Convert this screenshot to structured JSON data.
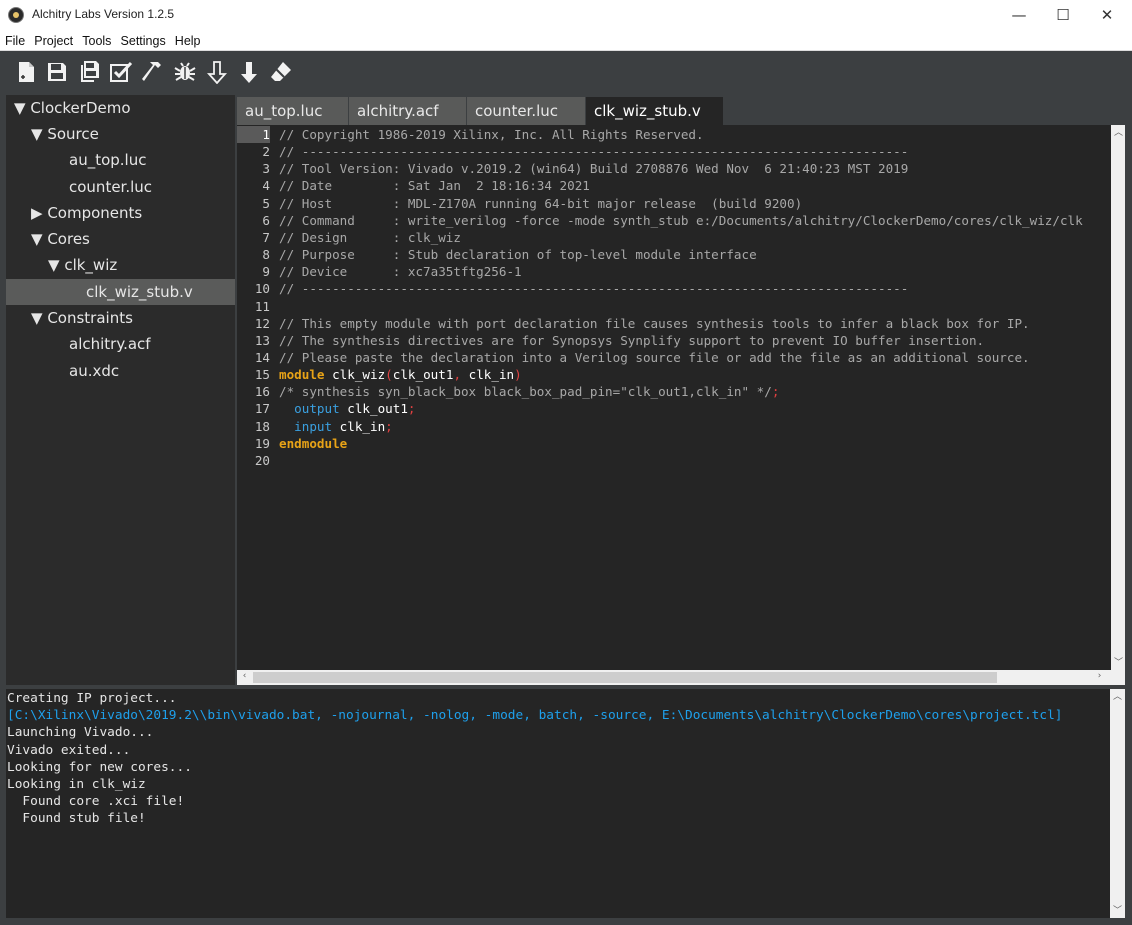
{
  "window": {
    "title": "Alchitry Labs Version 1.2.5",
    "buttons": [
      "—",
      "☐",
      "✕"
    ]
  },
  "menu": [
    "File",
    "Project",
    "Tools",
    "Settings",
    "Help"
  ],
  "toolbar": {
    "buttons": [
      "new-file",
      "save",
      "save-all",
      "check",
      "build",
      "debug",
      "load-ram",
      "load-flash",
      "erase"
    ]
  },
  "tree": {
    "items": [
      {
        "label": "ClockerDemo",
        "arrow": "▼"
      },
      {
        "label": "Source",
        "arrow": "▼"
      },
      {
        "label": "au_top.luc",
        "arrow": ""
      },
      {
        "label": "counter.luc",
        "arrow": ""
      },
      {
        "label": "Components",
        "arrow": "▶"
      },
      {
        "label": "Cores",
        "arrow": "▼"
      },
      {
        "label": "clk_wiz",
        "arrow": "▼"
      },
      {
        "label": "clk_wiz_stub.v",
        "arrow": ""
      },
      {
        "label": "Constraints",
        "arrow": "▼"
      },
      {
        "label": "alchitry.acf",
        "arrow": ""
      },
      {
        "label": "au.xdc",
        "arrow": ""
      }
    ]
  },
  "tabs": [
    {
      "label": "au_top.luc"
    },
    {
      "label": "alchitry.acf"
    },
    {
      "label": "counter.luc"
    },
    {
      "label": "clk_wiz_stub.v"
    }
  ],
  "editor": {
    "lines": [
      {
        "n": "1",
        "segs": [
          {
            "t": "// Copyright 1986-2019 Xilinx, Inc. All Rights Reserved.",
            "c": "#a8a8a8"
          }
        ]
      },
      {
        "n": "2",
        "segs": [
          {
            "t": "// --------------------------------------------------------------------------------",
            "c": "#a8a8a8"
          }
        ]
      },
      {
        "n": "3",
        "segs": [
          {
            "t": "// Tool Version: Vivado v.2019.2 (win64) Build 2708876 Wed Nov  6 21:40:23 MST 2019",
            "c": "#a8a8a8"
          }
        ]
      },
      {
        "n": "4",
        "segs": [
          {
            "t": "// Date        : Sat Jan  2 18:16:34 2021",
            "c": "#a8a8a8"
          }
        ]
      },
      {
        "n": "5",
        "segs": [
          {
            "t": "// Host        : MDL-Z170A running 64-bit major release  (build 9200)",
            "c": "#a8a8a8"
          }
        ]
      },
      {
        "n": "6",
        "segs": [
          {
            "t": "// Command     : write_verilog -force -mode synth_stub e:/Documents/alchitry/ClockerDemo/cores/clk_wiz/clk",
            "c": "#a8a8a8"
          }
        ]
      },
      {
        "n": "7",
        "segs": [
          {
            "t": "// Design      : clk_wiz",
            "c": "#a8a8a8"
          }
        ]
      },
      {
        "n": "8",
        "segs": [
          {
            "t": "// Purpose     : Stub declaration of top-level module interface",
            "c": "#a8a8a8"
          }
        ]
      },
      {
        "n": "9",
        "segs": [
          {
            "t": "// Device      : xc7a35tftg256-1",
            "c": "#a8a8a8"
          }
        ]
      },
      {
        "n": "10",
        "segs": [
          {
            "t": "// --------------------------------------------------------------------------------",
            "c": "#a8a8a8"
          }
        ]
      },
      {
        "n": "11",
        "segs": []
      },
      {
        "n": "12",
        "segs": [
          {
            "t": "// This empty module with port declaration file causes synthesis tools to infer a black box for IP.",
            "c": "#a8a8a8"
          }
        ]
      },
      {
        "n": "13",
        "segs": [
          {
            "t": "// The synthesis directives are for Synopsys Synplify support to prevent IO buffer insertion.",
            "c": "#a8a8a8"
          }
        ]
      },
      {
        "n": "14",
        "segs": [
          {
            "t": "// Please paste the declaration into a Verilog source file or add the file as an additional source.",
            "c": "#a8a8a8"
          }
        ]
      },
      {
        "n": "15",
        "segs": [
          {
            "t": "module",
            "c": "#e8a317",
            "b": true
          },
          {
            "t": " clk_wiz",
            "c": "#ffffff"
          },
          {
            "t": "(",
            "c": "#e04040"
          },
          {
            "t": "clk_out1",
            "c": "#ffffff"
          },
          {
            "t": ", ",
            "c": "#e04040"
          },
          {
            "t": "clk_in",
            "c": "#ffffff"
          },
          {
            "t": ")",
            "c": "#e04040"
          }
        ]
      },
      {
        "n": "16",
        "segs": [
          {
            "t": "/* synthesis syn_black_box black_box_pad_pin=\"clk_out1,clk_in\" */",
            "c": "#a8a8a8"
          },
          {
            "t": ";",
            "c": "#e04040"
          }
        ]
      },
      {
        "n": "17",
        "segs": [
          {
            "t": "  ",
            "c": "#ffffff"
          },
          {
            "t": "output",
            "c": "#3aa0e0"
          },
          {
            "t": " clk_out1",
            "c": "#ffffff"
          },
          {
            "t": ";",
            "c": "#e04040"
          }
        ]
      },
      {
        "n": "18",
        "segs": [
          {
            "t": "  ",
            "c": "#ffffff"
          },
          {
            "t": "input",
            "c": "#3aa0e0"
          },
          {
            "t": " clk_in",
            "c": "#ffffff"
          },
          {
            "t": ";",
            "c": "#e04040"
          }
        ]
      },
      {
        "n": "19",
        "segs": [
          {
            "t": "endmodule",
            "c": "#e8a317",
            "b": true
          }
        ]
      },
      {
        "n": "20",
        "segs": []
      }
    ]
  },
  "console": {
    "lines": [
      {
        "t": "Creating IP project...",
        "c": "#e6e6e6"
      },
      {
        "t": "[C:\\Xilinx\\Vivado\\2019.2\\\\bin\\vivado.bat, -nojournal, -nolog, -mode, batch, -source, E:\\Documents\\alchitry\\ClockerDemo\\cores\\project.tcl]",
        "c": "#1ea0ec"
      },
      {
        "t": "Launching Vivado...",
        "c": "#e6e6e6"
      },
      {
        "t": "Vivado exited...",
        "c": "#e6e6e6"
      },
      {
        "t": "Looking for new cores...",
        "c": "#e6e6e6"
      },
      {
        "t": "Looking in clk_wiz",
        "c": "#e6e6e6"
      },
      {
        "t": "  Found core .xci file!",
        "c": "#e6e6e6"
      },
      {
        "t": "  Found stub file!",
        "c": "#e6e6e6"
      }
    ]
  }
}
